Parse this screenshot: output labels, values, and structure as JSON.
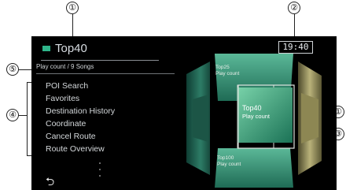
{
  "callouts": {
    "c1_top": "①",
    "c2": "②",
    "c5": "⑤",
    "c4": "④",
    "c1_right": "①",
    "c3": "③"
  },
  "header": {
    "title": "Top40",
    "subtitle": "Play count / 9 Songs",
    "time": "19:40"
  },
  "menu": {
    "items": [
      {
        "label": "POI Search"
      },
      {
        "label": "Favorites"
      },
      {
        "label": "Destination History"
      },
      {
        "label": "Coordinate"
      },
      {
        "label": "Cancel Route"
      },
      {
        "label": "Route Overview"
      }
    ]
  },
  "back_icon": "⮌",
  "wheel": {
    "upper": {
      "title": "Top25",
      "sub": "Play count"
    },
    "selected": {
      "title": "Top40",
      "sub": "Play count"
    },
    "lower": {
      "title": "Top100",
      "sub": "Play count"
    }
  },
  "colors": {
    "accent": "#2fb58a",
    "screen_bg": "#000000"
  },
  "icons": [
    "playlist-icon",
    "back-icon"
  ]
}
